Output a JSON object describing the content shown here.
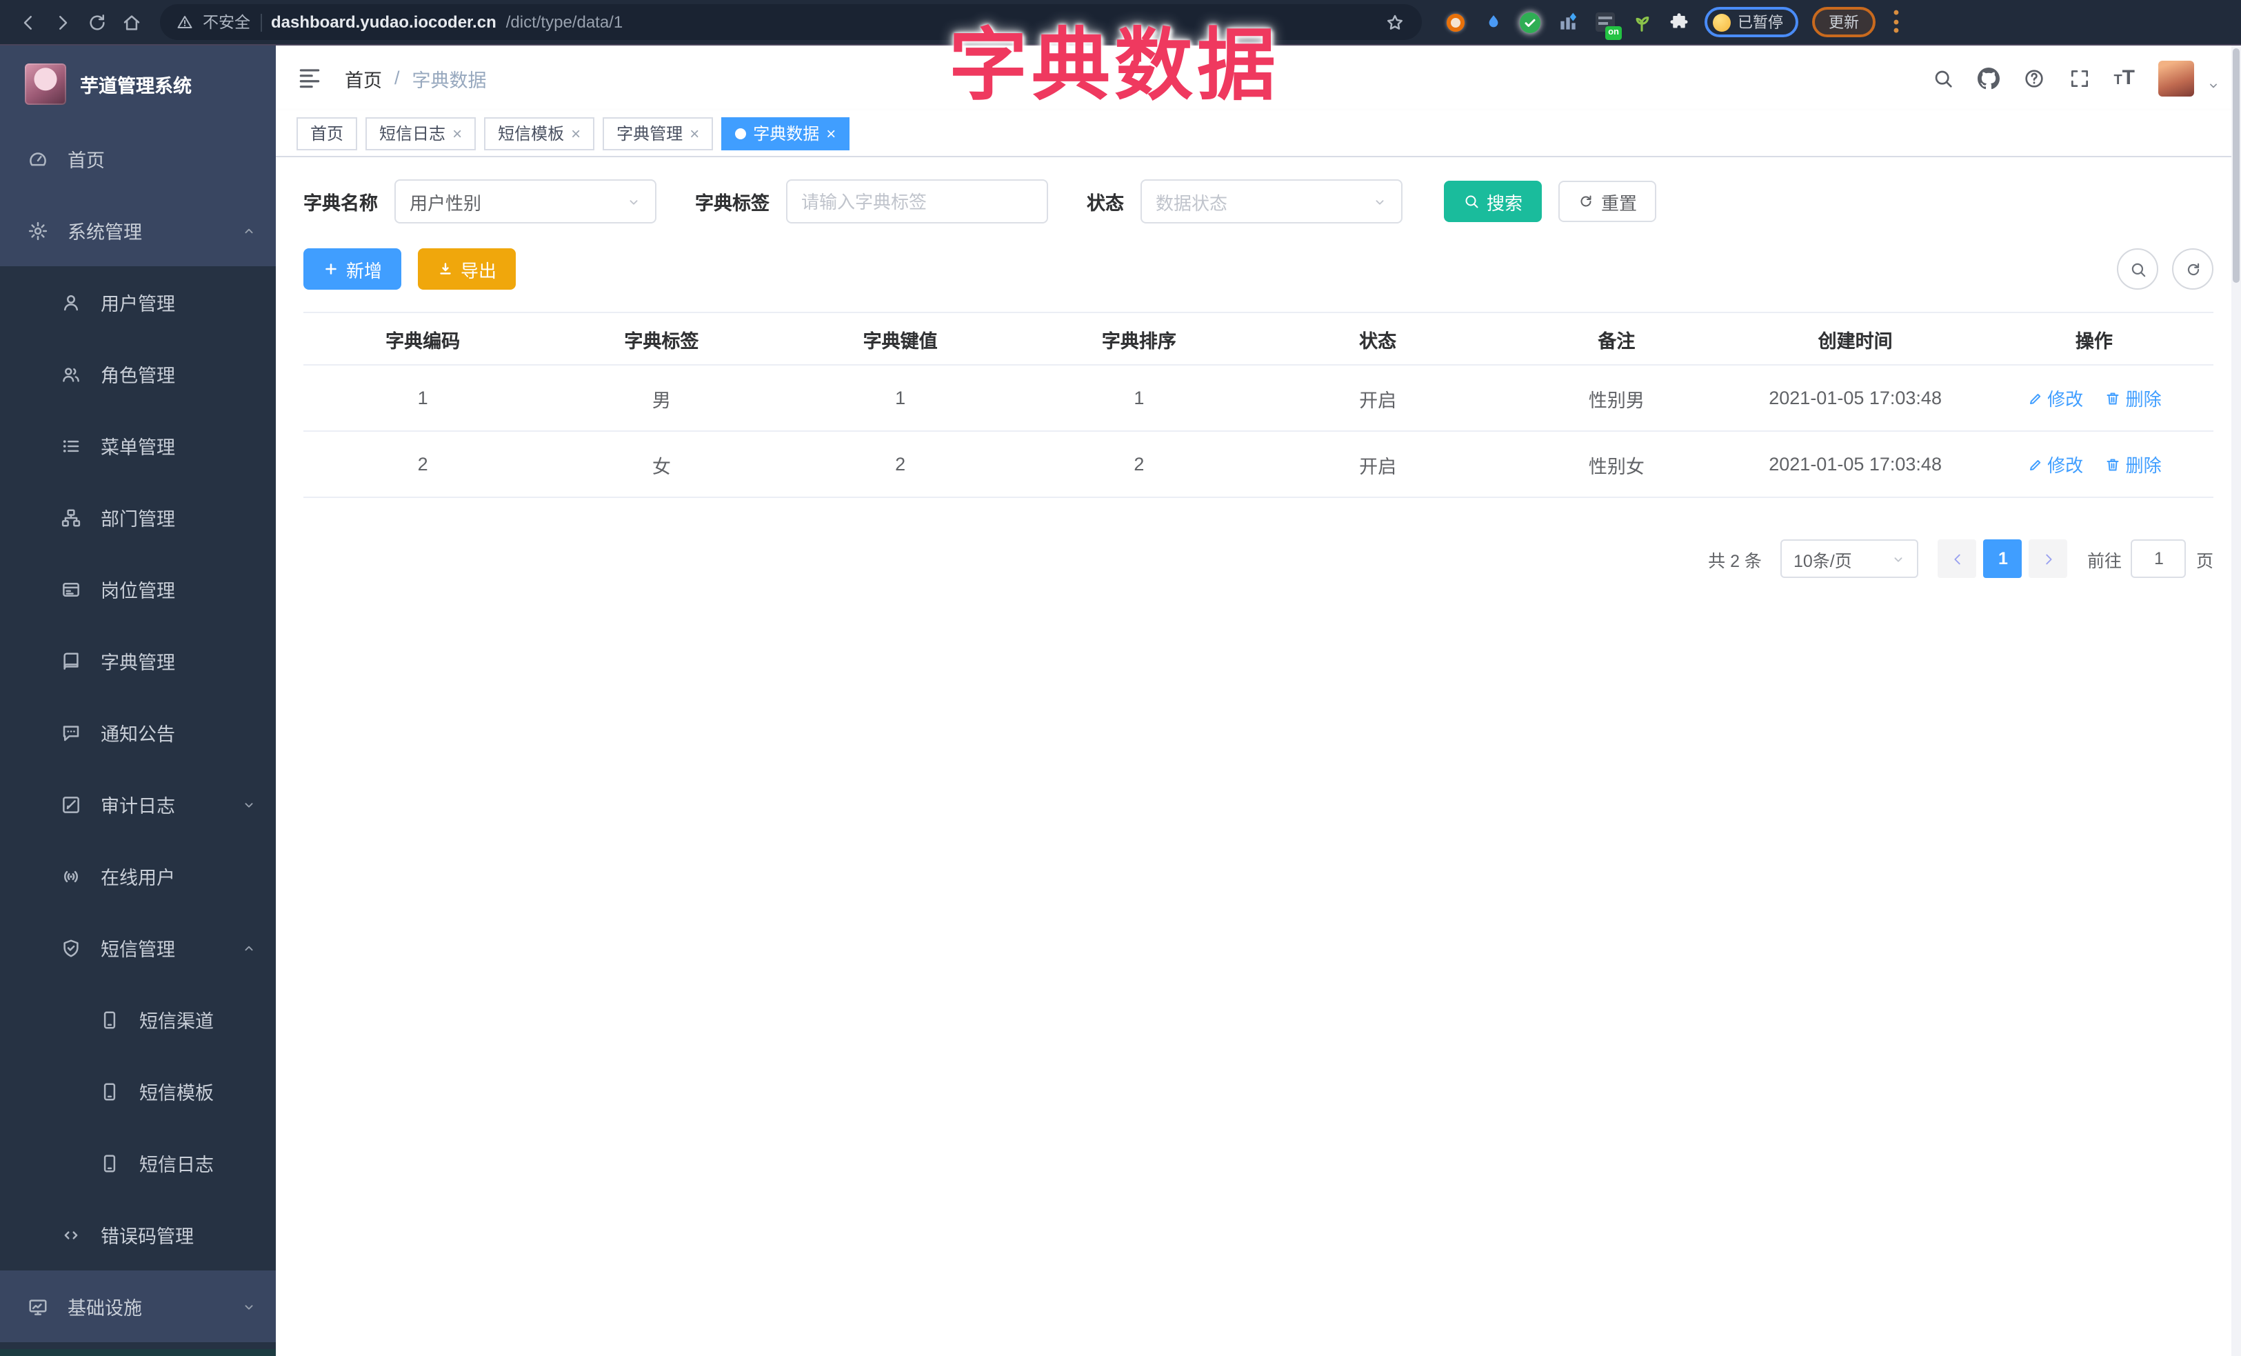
{
  "overlay_title": "字典数据",
  "browser": {
    "security_label": "不安全",
    "url_host": "dashboard.yudao.iocoder.cn",
    "url_path": "/dict/type/data/1",
    "paused_badge": "已暂停",
    "update_button": "更新",
    "extension_on_badge": "on"
  },
  "sidebar": {
    "logo_title": "芋道管理系统",
    "items": [
      {
        "label": "首页",
        "icon": "dashboard-icon",
        "level": 1
      },
      {
        "label": "系统管理",
        "icon": "gear-icon",
        "level": 1,
        "state": "expanded"
      },
      {
        "label": "用户管理",
        "icon": "user-icon",
        "level": 2
      },
      {
        "label": "角色管理",
        "icon": "users-icon",
        "level": 2
      },
      {
        "label": "菜单管理",
        "icon": "menu-list-icon",
        "level": 2
      },
      {
        "label": "部门管理",
        "icon": "org-tree-icon",
        "level": 2
      },
      {
        "label": "岗位管理",
        "icon": "id-card-icon",
        "level": 2
      },
      {
        "label": "字典管理",
        "icon": "book-icon",
        "level": 2
      },
      {
        "label": "通知公告",
        "icon": "announcement-icon",
        "level": 2
      },
      {
        "label": "审计日志",
        "icon": "audit-log-icon",
        "level": 2,
        "state": "collapsed"
      },
      {
        "label": "在线用户",
        "icon": "online-users-icon",
        "level": 2
      },
      {
        "label": "短信管理",
        "icon": "shield-check-icon",
        "level": 2,
        "state": "expanded"
      },
      {
        "label": "短信渠道",
        "icon": "phone-icon",
        "level": 3
      },
      {
        "label": "短信模板",
        "icon": "phone-icon",
        "level": 3
      },
      {
        "label": "短信日志",
        "icon": "phone-icon",
        "level": 3
      },
      {
        "label": "错误码管理",
        "icon": "code-icon",
        "level": 2
      },
      {
        "label": "基础设施",
        "icon": "monitor-icon",
        "level": 1,
        "state": "collapsed"
      }
    ]
  },
  "header": {
    "breadcrumb_home": "首页",
    "breadcrumb_separator": "/",
    "breadcrumb_current": "字典数据"
  },
  "tabs": [
    {
      "label": "首页",
      "closable": false,
      "active": false
    },
    {
      "label": "短信日志",
      "closable": true,
      "active": false
    },
    {
      "label": "短信模板",
      "closable": true,
      "active": false
    },
    {
      "label": "字典管理",
      "closable": true,
      "active": false
    },
    {
      "label": "字典数据",
      "closable": true,
      "active": true
    }
  ],
  "filters": {
    "dict_name_label": "字典名称",
    "dict_name_value": "用户性别",
    "dict_tag_label": "字典标签",
    "dict_tag_placeholder": "请输入字典标签",
    "status_label": "状态",
    "status_placeholder": "数据状态",
    "search_button": "搜索",
    "reset_button": "重置"
  },
  "toolbar": {
    "add_button": "新增",
    "export_button": "导出"
  },
  "table": {
    "columns": [
      "字典编码",
      "字典标签",
      "字典键值",
      "字典排序",
      "状态",
      "备注",
      "创建时间",
      "操作"
    ],
    "rows": [
      {
        "code": "1",
        "label": "男",
        "value": "1",
        "sort": "1",
        "status": "开启",
        "remark": "性别男",
        "created_at": "2021-01-05 17:03:48"
      },
      {
        "code": "2",
        "label": "女",
        "value": "2",
        "sort": "2",
        "status": "开启",
        "remark": "性别女",
        "created_at": "2021-01-05 17:03:48"
      }
    ],
    "edit_action": "修改",
    "delete_action": "删除"
  },
  "pagination": {
    "total_text": "共 2 条",
    "page_size_text": "10条/页",
    "current_page": "1",
    "goto_label": "前往",
    "goto_value": "1",
    "page_unit": "页"
  },
  "colors": {
    "primary_blue": "#409eff",
    "search_teal": "#1abc9c",
    "export_amber": "#f0a70c",
    "overlay_pink": "#ef395f",
    "sidebar_dark": "#263243",
    "sidebar_light": "#394661"
  }
}
